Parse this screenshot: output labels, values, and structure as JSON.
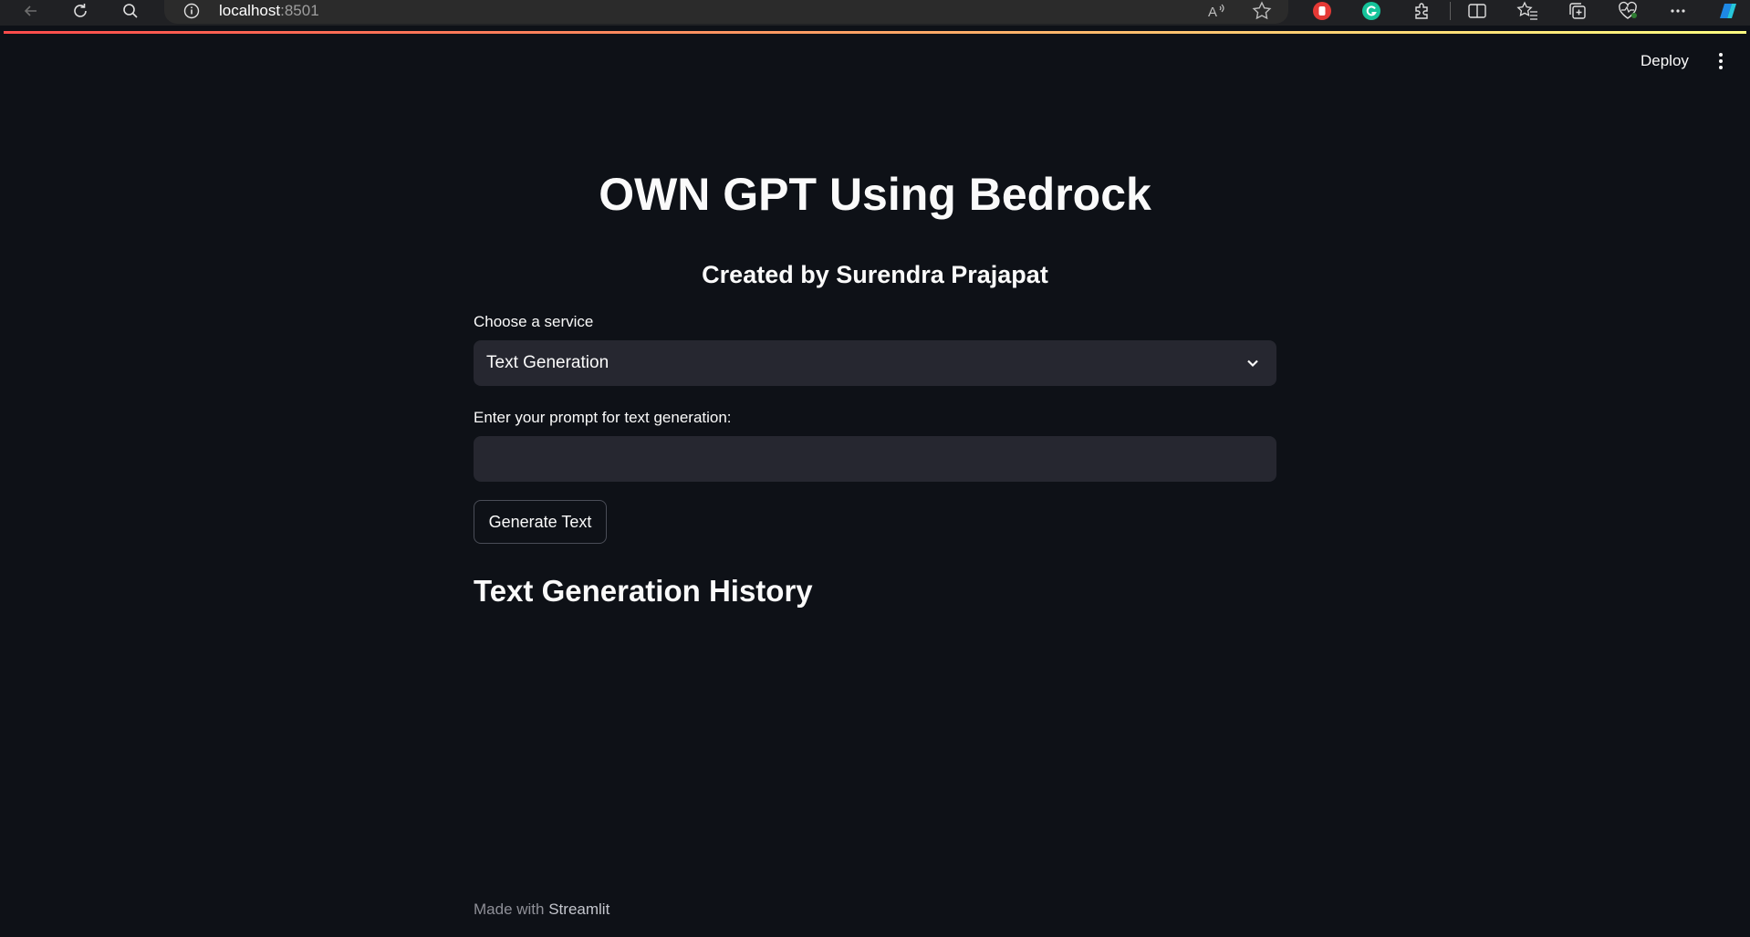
{
  "browser": {
    "url_host": "localhost",
    "url_port": ":8501"
  },
  "header": {
    "deploy_label": "Deploy"
  },
  "main": {
    "title": "OWN GPT Using Bedrock",
    "subtitle": "Created by Surendra Prajapat",
    "service_select": {
      "label": "Choose a service",
      "selected": "Text Generation"
    },
    "prompt": {
      "label": "Enter your prompt for text generation:",
      "value": "",
      "placeholder": ""
    },
    "generate_button_label": "Generate Text",
    "history_heading": "Text Generation History"
  },
  "footer": {
    "made_with": "Made with",
    "brand": "Streamlit"
  },
  "colors": {
    "background": "#0e1117",
    "widget_background": "#262730",
    "decoration_start": "#ff4b4b",
    "decoration_end": "#fffd80"
  },
  "icons": [
    "back-icon",
    "refresh-icon",
    "search-icon",
    "info-icon",
    "read-aloud-icon",
    "favorite-icon",
    "stop-extension-icon",
    "grammarly-icon",
    "extensions-icon",
    "split-screen-icon",
    "favorites-icon",
    "collections-icon",
    "browser-essentials-icon",
    "more-icon",
    "copilot-icon",
    "chevron-down-icon"
  ]
}
